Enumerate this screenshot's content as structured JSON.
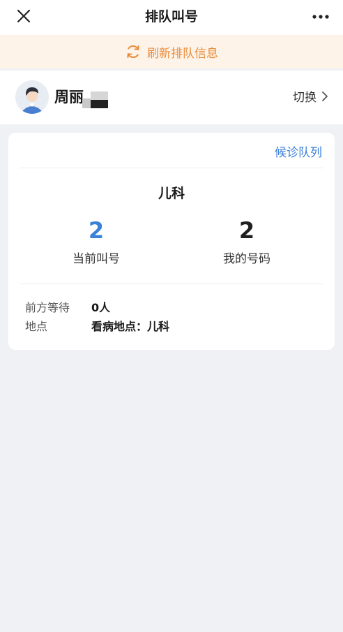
{
  "nav": {
    "title": "排队叫号",
    "close_icon": "close-icon",
    "more_icon": "more-dots-icon"
  },
  "refresh": {
    "label": "刷新排队信息",
    "icon": "refresh-icon",
    "color": "#e98c3a"
  },
  "patient": {
    "name": "周丽",
    "switch_label": "切换",
    "avatar_icon": "user-avatar",
    "chevron_icon": "chevron-right-icon"
  },
  "queue": {
    "link_label": "候诊队列",
    "department": "儿科",
    "current_number": "2",
    "current_label": "当前叫号",
    "my_number": "2",
    "my_label": "我的号码",
    "waiting_label": "前方等待",
    "waiting_value": "0人",
    "location_label": "地点",
    "location_value": "看病地点：儿科"
  },
  "colors": {
    "accent_blue": "#3a82d8",
    "link_blue": "#3a7fd5",
    "refresh_bg": "#fdf3e9",
    "page_bg": "#f0f1f5"
  }
}
